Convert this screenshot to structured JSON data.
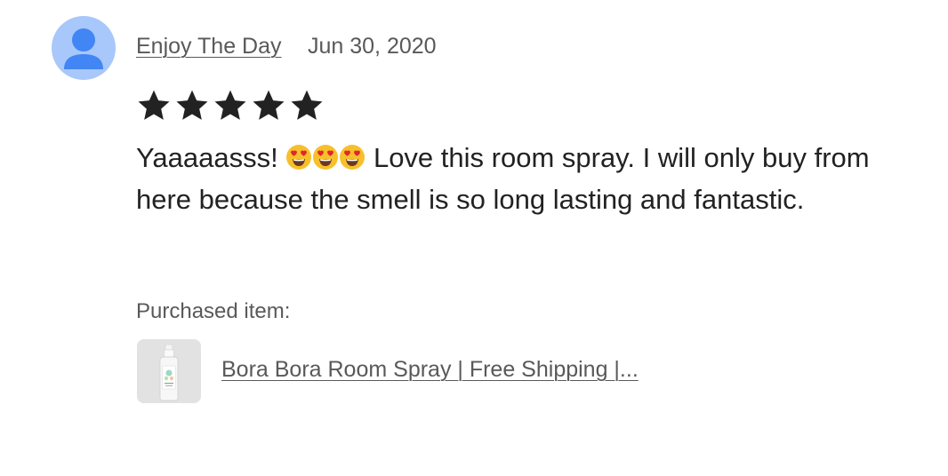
{
  "review": {
    "author": "Enjoy The Day",
    "date": "Jun 30, 2020",
    "rating": 5,
    "rating_max": 5,
    "text_before_emoji": "Yaaaaasss!",
    "emoji": [
      "heart-eyes-emoji",
      "heart-eyes-emoji",
      "heart-eyes-emoji"
    ],
    "text_after_emoji": "Love this room spray. I will only buy from here because the smell is so long lasting and fantastic."
  },
  "purchased": {
    "label": "Purchased item:",
    "item_title": "Bora Bora Room Spray | Free Shipping |...",
    "thumbnail_icon": "spray-bottle-image"
  },
  "colors": {
    "avatar_bg": "#a8c7fa",
    "avatar_fg": "#4285f4",
    "star": "#222222",
    "muted_text": "#595959",
    "body_text": "#222222"
  }
}
